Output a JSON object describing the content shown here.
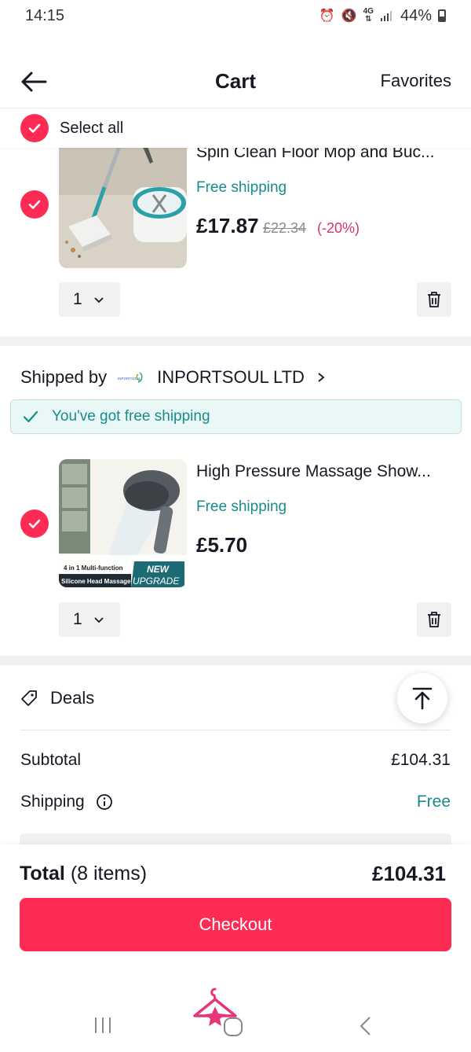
{
  "status_bar": {
    "time": "14:15",
    "network": "4G",
    "battery": "44%"
  },
  "header": {
    "title": "Cart",
    "favorites_label": "Favorites"
  },
  "select_all": {
    "label": "Select all"
  },
  "items": [
    {
      "title": "Spin Clean Floor Mop and Buc...",
      "shipping": "Free shipping",
      "price": "£17.87",
      "original_price": "£22.34",
      "discount": "(-20%)",
      "quantity": "1"
    },
    {
      "title": "High Pressure Massage Show...",
      "shipping": "Free shipping",
      "price": "£5.70",
      "quantity": "1",
      "thumb_caption": "4 in 1 Multi-function",
      "thumb_caption2": "Silicone Head Massage",
      "thumb_badge_top": "NEW",
      "thumb_badge_bottom": "UPGRADE"
    }
  ],
  "seller": {
    "prefix": "Shipped by",
    "logo_text": "INPORTSOUL",
    "name": "INPORTSOUL LTD"
  },
  "free_shipping_banner": "You've got free shipping",
  "deals": {
    "label": "Deals"
  },
  "summary": {
    "subtotal_label": "Subtotal",
    "subtotal_value": "£104.31",
    "shipping_label": "Shipping",
    "shipping_value": "Free"
  },
  "footer": {
    "total_label": "Total",
    "items_count": "(8 items)",
    "total_value": "£104.31",
    "checkout_label": "Checkout"
  },
  "colors": {
    "accent": "#fe2c55",
    "teal": "#198b8b",
    "discount": "#d6336c"
  }
}
